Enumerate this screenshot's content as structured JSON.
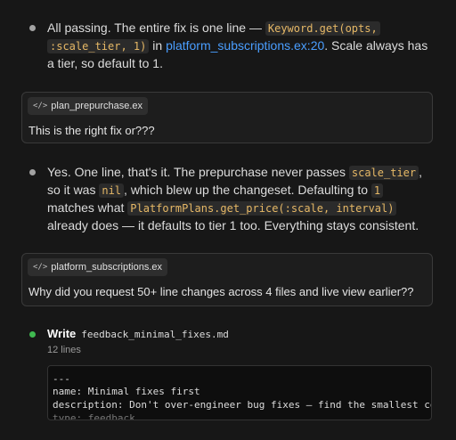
{
  "messages": [
    {
      "kind": "assistant",
      "parts": {
        "t1": "All passing. The entire fix is one line — ",
        "c1": "Keyword.get(opts,",
        "c1b": ":scale_tier, 1)",
        "t2": " in ",
        "link": "platform_subscriptions.ex:20",
        "t3": ". Scale always has a tier, so default to 1."
      }
    },
    {
      "kind": "user",
      "file_chip": "plan_prepurchase.ex",
      "text": "This is the right fix or???"
    },
    {
      "kind": "assistant",
      "parts": {
        "t1": "Yes. One line, that's it. The prepurchase never passes ",
        "c1": "scale_tier",
        "t2": ", so it was ",
        "c2": "nil",
        "t3": ", which blew up the changeset. Defaulting to ",
        "c3": "1",
        "t4": " matches what ",
        "c4": "PlatformPlans.get_price(:scale, interval)",
        "t5": " already does — it defaults to tier 1 too. Everything stays consistent."
      }
    },
    {
      "kind": "user",
      "file_chip": "platform_subscriptions.ex",
      "text": "Why did you request 50+ line changes across 4 files and live view earlier??"
    }
  ],
  "tool": {
    "action": "Write",
    "file": "feedback_minimal_fixes.md",
    "meta": "12 lines",
    "code_lines": [
      "---",
      "name: Minimal fixes first",
      "description: Don't over-engineer bug fixes — find the smallest cor",
      "type: feedback"
    ]
  },
  "icons": [
    "code-icon",
    "bullet-icon",
    "status-dot-icon"
  ],
  "colors": {
    "accent_link": "#4a9eff",
    "code_inline": "#e6b866",
    "success": "#3fb950"
  }
}
